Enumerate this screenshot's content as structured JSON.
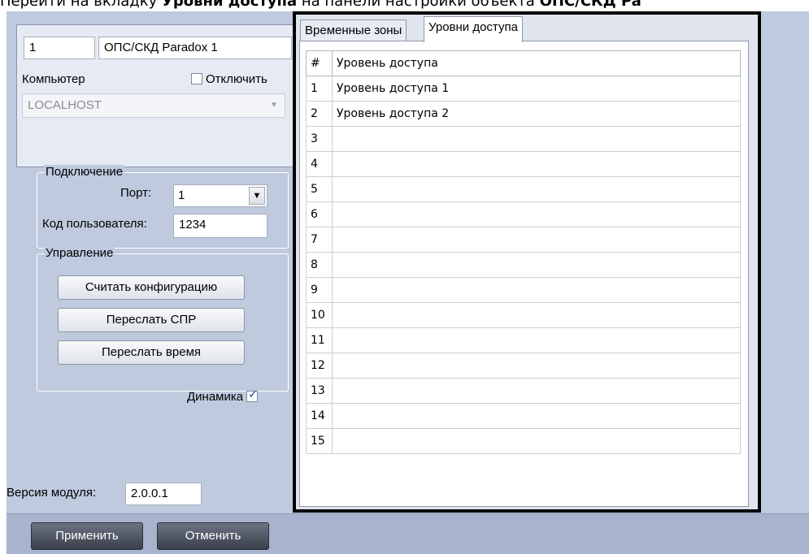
{
  "caption": {
    "prefix": "Перейти на вкладку ",
    "bold1": "Уровни доступа",
    "middle": " на панели настройки объекта ",
    "bold2": "ОПС/СКД Pa"
  },
  "object": {
    "id": "1",
    "name": "ОПС/СКД Paradox 1"
  },
  "computer": {
    "label": "Компьютер",
    "disable_label": "Отключить",
    "disabled": false,
    "host": "LOCALHOST"
  },
  "connection": {
    "title": "Подключение",
    "port_label": "Порт:",
    "port_value": "1",
    "user_code_label": "Код пользователя:",
    "user_code_value": "1234"
  },
  "control": {
    "title": "Управление",
    "read_config": "Считать конфигурацию",
    "send_spr": "Переслать СПР",
    "send_time": "Переслать время"
  },
  "dynamics": {
    "label": "Динамика",
    "checked": true
  },
  "module_version": {
    "label": "Версия модуля:",
    "value": "2.0.0.1"
  },
  "tabs": [
    {
      "label": "Временные зоны"
    },
    {
      "label": "Уровни доступа"
    }
  ],
  "grid": {
    "header_num": "#",
    "header_name": "Уровень доступа",
    "rows": [
      {
        "num": "1",
        "name": "Уровень доступа 1"
      },
      {
        "num": "2",
        "name": "Уровень доступа 2"
      },
      {
        "num": "3",
        "name": ""
      },
      {
        "num": "4",
        "name": ""
      },
      {
        "num": "5",
        "name": ""
      },
      {
        "num": "6",
        "name": ""
      },
      {
        "num": "7",
        "name": ""
      },
      {
        "num": "8",
        "name": ""
      },
      {
        "num": "9",
        "name": ""
      },
      {
        "num": "10",
        "name": ""
      },
      {
        "num": "11",
        "name": ""
      },
      {
        "num": "12",
        "name": ""
      },
      {
        "num": "13",
        "name": ""
      },
      {
        "num": "14",
        "name": ""
      },
      {
        "num": "15",
        "name": ""
      }
    ]
  },
  "footer": {
    "apply": "Применить",
    "cancel": "Отменить"
  },
  "colors": {
    "app_bg": "#bfcadf",
    "footer_bg": "#a8b4cd",
    "accent_border": "#000000"
  }
}
